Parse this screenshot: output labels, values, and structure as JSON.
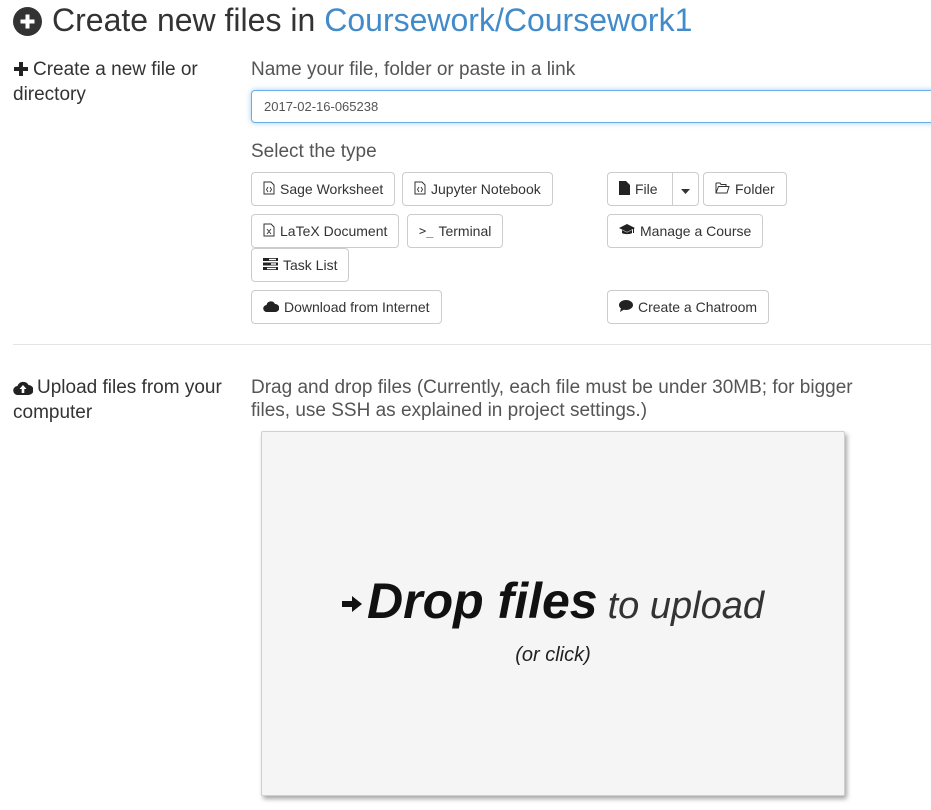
{
  "header": {
    "title_prefix": "Create new files in",
    "path_link": "Coursework/Coursework1"
  },
  "create_section": {
    "label": "Create a new file or directory",
    "name_prompt": "Name your file, folder or paste in a link",
    "name_value": "2017-02-16-065238",
    "type_prompt": "Select the type",
    "buttons": {
      "sage_worksheet": "Sage Worksheet",
      "jupyter_notebook": "Jupyter Notebook",
      "file": "File",
      "folder": "Folder",
      "latex_document": "LaTeX Document",
      "terminal": "Terminal",
      "manage_course": "Manage a Course",
      "task_list": "Task List",
      "download_internet": "Download from Internet",
      "create_chatroom": "Create a Chatroom"
    }
  },
  "upload_section": {
    "label": "Upload files from your computer",
    "description": "Drag and drop files (Currently, each file must be under 30MB; for bigger files, use SSH as explained in project settings.)",
    "drop_strong": "Drop files",
    "drop_light": "to upload",
    "drop_sub": "(or click)"
  },
  "colors": {
    "link": "#428bca",
    "input_focus": "#66afe9"
  },
  "icons": [
    "plus-circle-icon",
    "plus-icon",
    "cloud-upload-icon",
    "file-code-icon",
    "file-icon",
    "caret-down-icon",
    "folder-open-icon",
    "file-excel-icon",
    "terminal-icon",
    "graduation-cap-icon",
    "tasks-icon",
    "cloud-icon",
    "comment-icon",
    "arrow-right-icon"
  ]
}
